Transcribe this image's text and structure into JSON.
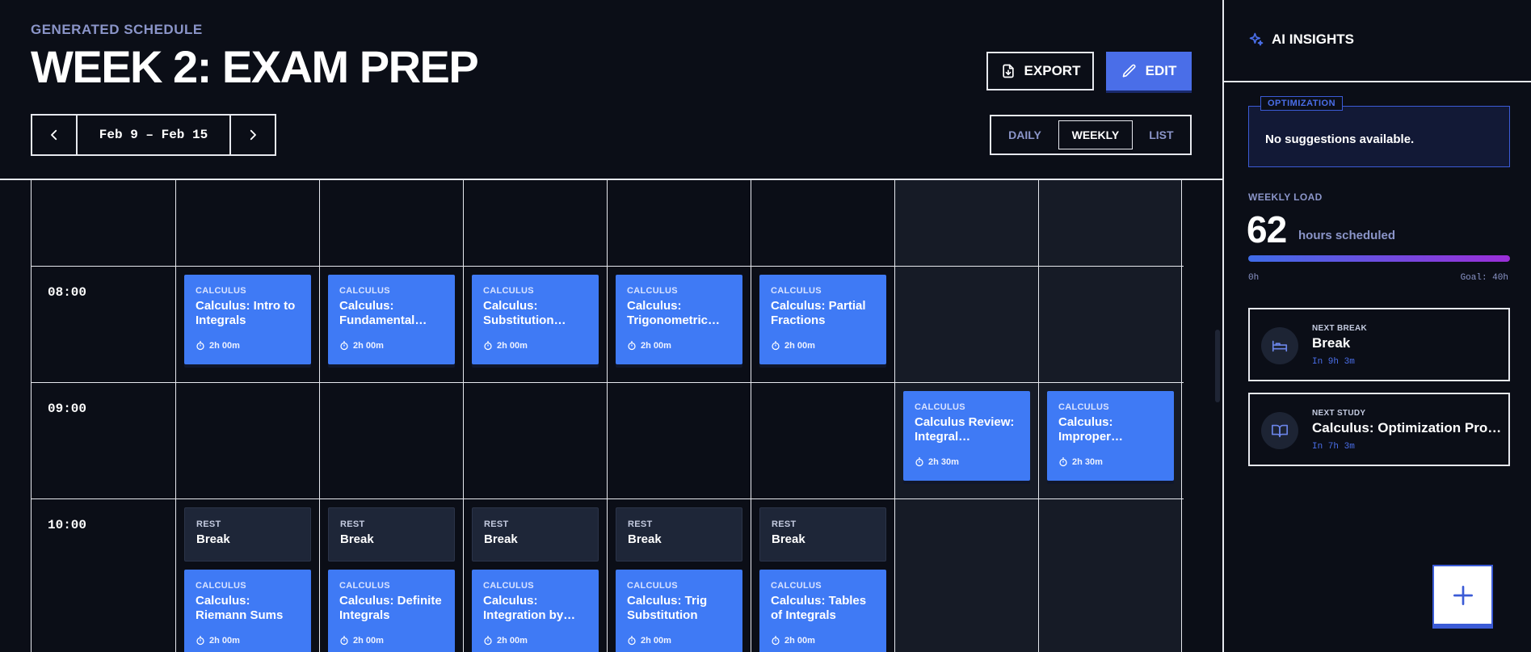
{
  "header": {
    "eyebrow": "GENERATED SCHEDULE",
    "title": "WEEK 2: EXAM PREP",
    "export_label": "EXPORT",
    "edit_label": "EDIT",
    "date_range": "Feb 9 – Feb 15",
    "views": [
      "DAILY",
      "WEEKLY",
      "LIST"
    ],
    "active_view": "WEEKLY"
  },
  "times": [
    "08:00",
    "09:00",
    "10:00"
  ],
  "row_08": [
    {
      "category": "CALCULUS",
      "title": "Calculus: Intro to Integrals",
      "duration": "2h 00m"
    },
    {
      "category": "CALCULUS",
      "title": "Calculus: Fundamental…",
      "duration": "2h 00m"
    },
    {
      "category": "CALCULUS",
      "title": "Calculus: Substitution…",
      "duration": "2h 00m"
    },
    {
      "category": "CALCULUS",
      "title": "Calculus: Trigonometric…",
      "duration": "2h 00m"
    },
    {
      "category": "CALCULUS",
      "title": "Calculus: Partial Fractions",
      "duration": "2h 00m"
    }
  ],
  "row_09": [
    {
      "category": "CALCULUS",
      "title": "Calculus Review: Integral…",
      "duration": "2h 30m"
    },
    {
      "category": "CALCULUS",
      "title": "Calculus: Improper…",
      "duration": "2h 30m"
    }
  ],
  "row_10_rest": [
    {
      "category": "REST",
      "title": "Break"
    },
    {
      "category": "REST",
      "title": "Break"
    },
    {
      "category": "REST",
      "title": "Break"
    },
    {
      "category": "REST",
      "title": "Break"
    },
    {
      "category": "REST",
      "title": "Break"
    }
  ],
  "row_10_study": [
    {
      "category": "CALCULUS",
      "title": "Calculus: Riemann Sums",
      "duration": "2h 00m"
    },
    {
      "category": "CALCULUS",
      "title": "Calculus: Definite Integrals",
      "duration": "2h 00m"
    },
    {
      "category": "CALCULUS",
      "title": "Calculus: Integration by…",
      "duration": "2h 00m"
    },
    {
      "category": "CALCULUS",
      "title": "Calculus: Trig Substitution",
      "duration": "2h 00m"
    },
    {
      "category": "CALCULUS",
      "title": "Calculus: Tables of Integrals",
      "duration": "2h 00m"
    }
  ],
  "sidebar": {
    "title": "AI INSIGHTS",
    "optimization_tag": "OPTIMIZATION",
    "optimization_text": "No suggestions available.",
    "load_label": "WEEKLY LOAD",
    "load_hours": "62",
    "load_unit": "hours scheduled",
    "load_fraction": 1.0,
    "load_min": "0h",
    "load_max": "Goal: 40h",
    "next_break": {
      "label": "NEXT BREAK",
      "title": "Break",
      "eta": "In 9h 3m"
    },
    "next_study": {
      "label": "NEXT STUDY",
      "title": "Calculus: Optimization Pro…",
      "eta": "In 7h 3m"
    }
  },
  "colors": {
    "background": "#0b0e17",
    "accent": "#4a6ee8",
    "study_card": "#3f7af5",
    "rest_card": "#1e2638"
  }
}
